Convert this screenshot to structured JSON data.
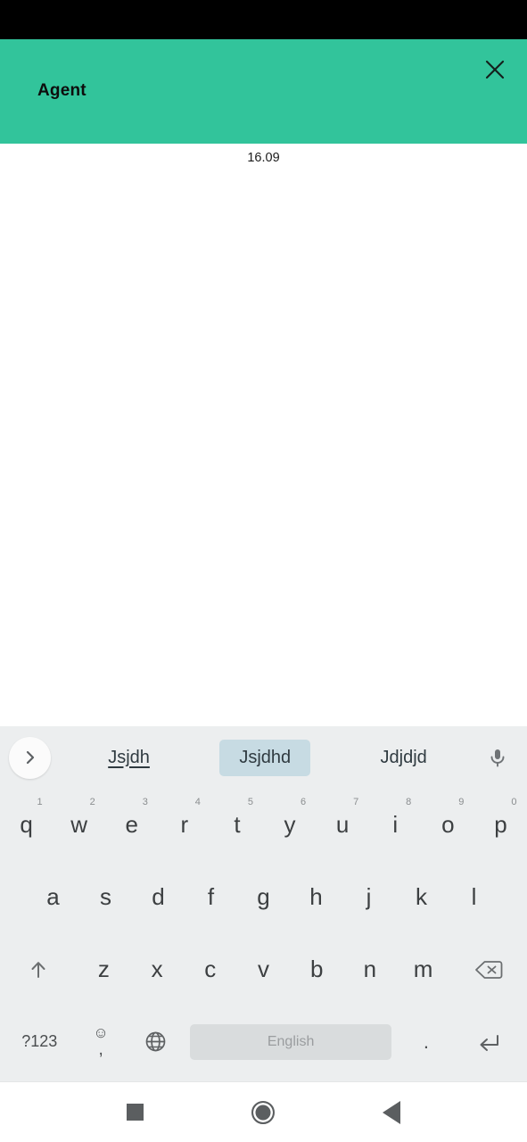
{
  "colors": {
    "header_bg": "#32c49b",
    "status_bar": "#000000",
    "keyboard_bg": "#eceeef",
    "suggestion_selected_bg": "#c7dbe3",
    "spacebar_bg": "#d9dcdd",
    "key_text": "#3c3f41",
    "nav_icon": "#5b5e60"
  },
  "header": {
    "title": "Agent",
    "close_icon": "close-icon"
  },
  "conversation": {
    "timestamp": "16.09"
  },
  "keyboard": {
    "expand_icon": "chevron-right-icon",
    "mic_icon": "microphone-icon",
    "suggestions": [
      {
        "label": "Jsjdh",
        "style": "underlined"
      },
      {
        "label": "Jsjdhd",
        "style": "selected"
      },
      {
        "label": "Jdjdjd",
        "style": "plain"
      }
    ],
    "row1": [
      {
        "key": "q",
        "hint": "1"
      },
      {
        "key": "w",
        "hint": "2"
      },
      {
        "key": "e",
        "hint": "3"
      },
      {
        "key": "r",
        "hint": "4"
      },
      {
        "key": "t",
        "hint": "5"
      },
      {
        "key": "y",
        "hint": "6"
      },
      {
        "key": "u",
        "hint": "7"
      },
      {
        "key": "i",
        "hint": "8"
      },
      {
        "key": "o",
        "hint": "9"
      },
      {
        "key": "p",
        "hint": "0"
      }
    ],
    "row2": [
      {
        "key": "a"
      },
      {
        "key": "s"
      },
      {
        "key": "d"
      },
      {
        "key": "f"
      },
      {
        "key": "g"
      },
      {
        "key": "h"
      },
      {
        "key": "j"
      },
      {
        "key": "k"
      },
      {
        "key": "l"
      }
    ],
    "row3": [
      {
        "key": "z"
      },
      {
        "key": "x"
      },
      {
        "key": "c"
      },
      {
        "key": "v"
      },
      {
        "key": "b"
      },
      {
        "key": "n"
      },
      {
        "key": "m"
      }
    ],
    "shift_icon": "shift-arrow-up-icon",
    "backspace_icon": "backspace-icon",
    "symbols_label": "?123",
    "emoji_glyph": "☺",
    "comma_glyph": ",",
    "globe_icon": "globe-language-icon",
    "spacebar_label": "English",
    "period_label": ".",
    "enter_icon": "enter-return-icon"
  },
  "navbar": {
    "recents_icon": "recents-square-icon",
    "home_icon": "home-circle-icon",
    "back_icon": "back-triangle-icon"
  }
}
